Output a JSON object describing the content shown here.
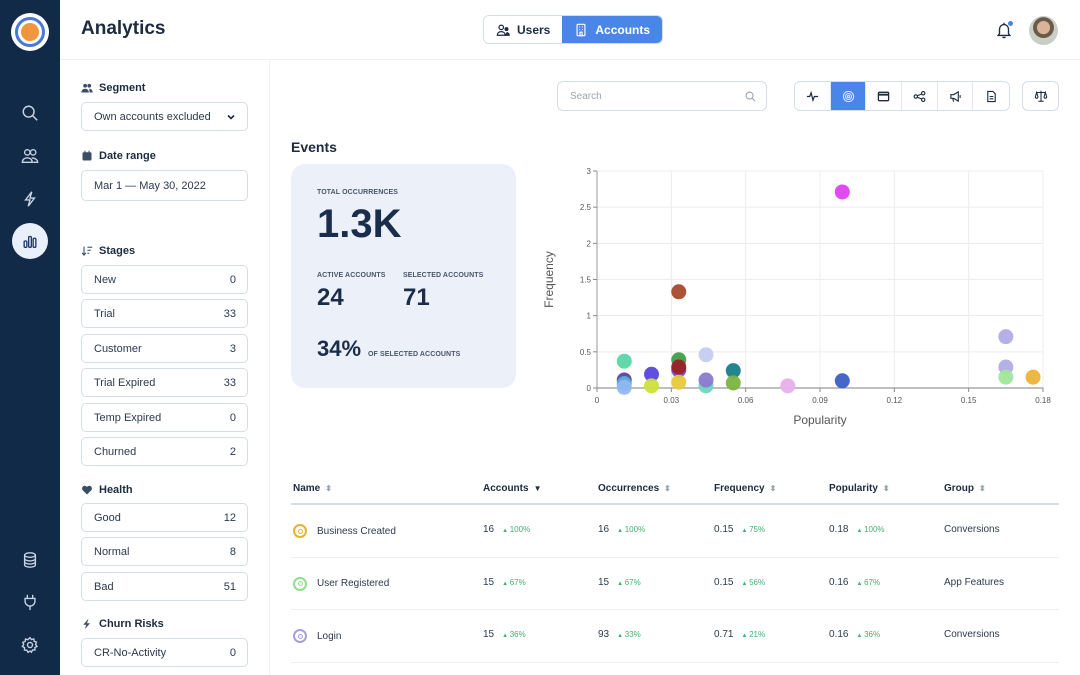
{
  "header": {
    "title": "Analytics",
    "toggle": [
      {
        "label": "Users",
        "icon": "users-icon",
        "active": false
      },
      {
        "label": "Accounts",
        "icon": "building-icon",
        "active": true
      }
    ],
    "notifications_icon": "bell-icon",
    "avatar": "user-avatar"
  },
  "rail": {
    "top_items": [
      {
        "name": "search",
        "icon": "search-icon"
      },
      {
        "name": "people",
        "icon": "people-icon"
      },
      {
        "name": "events",
        "icon": "lightning-icon"
      },
      {
        "name": "analytics",
        "icon": "bar-chart-icon",
        "active": true
      }
    ],
    "bottom_items": [
      {
        "name": "data",
        "icon": "database-icon"
      },
      {
        "name": "integrations",
        "icon": "plug-icon"
      },
      {
        "name": "settings",
        "icon": "gear-icon"
      }
    ]
  },
  "filters": {
    "segment": {
      "label": "Segment",
      "value": "Own accounts excluded"
    },
    "date_range": {
      "label": "Date range",
      "value": "Mar 1 — May 30, 2022"
    },
    "stages": {
      "label": "Stages",
      "items": [
        {
          "label": "New",
          "count": "0"
        },
        {
          "label": "Trial",
          "count": "33"
        },
        {
          "label": "Customer",
          "count": "3"
        },
        {
          "label": "Trial Expired",
          "count": "33"
        },
        {
          "label": "Temp Expired",
          "count": "0"
        },
        {
          "label": "Churned",
          "count": "2"
        }
      ]
    },
    "health": {
      "label": "Health",
      "items": [
        {
          "label": "Good",
          "count": "12"
        },
        {
          "label": "Normal",
          "count": "8"
        },
        {
          "label": "Bad",
          "count": "51"
        }
      ]
    },
    "churn_risks": {
      "label": "Churn Risks",
      "items": [
        {
          "label": "CR-No-Activity",
          "count": "0"
        }
      ]
    }
  },
  "toolbar": {
    "search_placeholder": "Search",
    "views": [
      {
        "name": "pulse",
        "icon": "pulse-icon",
        "active": false
      },
      {
        "name": "target",
        "icon": "target-icon",
        "active": true
      },
      {
        "name": "window",
        "icon": "window-icon",
        "active": false
      },
      {
        "name": "share",
        "icon": "share-nodes-icon",
        "active": false
      },
      {
        "name": "announce",
        "icon": "megaphone-icon",
        "active": false
      },
      {
        "name": "document",
        "icon": "document-icon",
        "active": false
      }
    ],
    "compare_icon": "scale-icon"
  },
  "events": {
    "title": "Events",
    "total_occurrences_label": "TOTAL OCCURRENCES",
    "total_occurrences": "1.3K",
    "active_accounts_label": "ACTIVE ACCOUNTS",
    "active_accounts": "24",
    "selected_accounts_label": "SELECTED ACCOUNTS",
    "selected_accounts": "71",
    "percent": "34%",
    "percent_label": "OF SELECTED ACCOUNTS"
  },
  "chart_data": {
    "type": "scatter",
    "title": "",
    "xlabel": "Popularity",
    "ylabel": "Frequency",
    "xlim": [
      0,
      0.18
    ],
    "ylim": [
      0,
      3
    ],
    "xticks": [
      "0",
      "0.03",
      "0.06",
      "0.09",
      "0.12",
      "0.15",
      "0.18"
    ],
    "yticks": [
      "0",
      "0.5",
      "1",
      "1.5",
      "2",
      "2.5",
      "3"
    ],
    "grid": true,
    "legend": "none",
    "points": [
      {
        "x": 0.099,
        "y": 2.71,
        "color": "#e040f0"
      },
      {
        "x": 0.033,
        "y": 1.33,
        "color": "#a84a2c"
      },
      {
        "x": 0.165,
        "y": 0.71,
        "color": "#b1ace6"
      },
      {
        "x": 0.165,
        "y": 0.29,
        "color": "#b1ace6"
      },
      {
        "x": 0.165,
        "y": 0.15,
        "color": "#9fe89a"
      },
      {
        "x": 0.176,
        "y": 0.15,
        "color": "#ecb33a"
      },
      {
        "x": 0.099,
        "y": 0.1,
        "color": "#3b5fc4"
      },
      {
        "x": 0.077,
        "y": 0.03,
        "color": "#e6b0ec"
      },
      {
        "x": 0.055,
        "y": 0.24,
        "color": "#178089"
      },
      {
        "x": 0.055,
        "y": 0.07,
        "color": "#7cb342"
      },
      {
        "x": 0.044,
        "y": 0.46,
        "color": "#c4cdf0"
      },
      {
        "x": 0.044,
        "y": 0.03,
        "color": "#6fd6c0"
      },
      {
        "x": 0.044,
        "y": 0.11,
        "color": "#8a7bd0"
      },
      {
        "x": 0.033,
        "y": 0.39,
        "color": "#3e9e4c"
      },
      {
        "x": 0.033,
        "y": 0.25,
        "color": "#6a4fd8"
      },
      {
        "x": 0.033,
        "y": 0.29,
        "color": "#9b2226"
      },
      {
        "x": 0.033,
        "y": 0.08,
        "color": "#e8c93c"
      },
      {
        "x": 0.022,
        "y": 0.19,
        "color": "#5b45e0"
      },
      {
        "x": 0.022,
        "y": 0.03,
        "color": "#cfe03a"
      },
      {
        "x": 0.011,
        "y": 0.37,
        "color": "#5ad6a8"
      },
      {
        "x": 0.011,
        "y": 0.11,
        "color": "#5a3fa8"
      },
      {
        "x": 0.011,
        "y": 0.06,
        "color": "#5bb0d8"
      },
      {
        "x": 0.011,
        "y": 0.01,
        "color": "#90b8f0"
      }
    ]
  },
  "table": {
    "columns": [
      {
        "label": "Name",
        "sort": "none"
      },
      {
        "label": "Accounts",
        "sort": "desc"
      },
      {
        "label": "Occurrences",
        "sort": "none"
      },
      {
        "label": "Frequency",
        "sort": "none"
      },
      {
        "label": "Popularity",
        "sort": "none"
      },
      {
        "label": "Group",
        "sort": "none"
      }
    ],
    "rows": [
      {
        "icon_color": "#e8b230",
        "name": "Business Created",
        "accounts": "16",
        "accounts_delta": "100%",
        "occurrences": "16",
        "occurrences_delta": "100%",
        "frequency": "0.15",
        "frequency_delta": "75%",
        "popularity": "0.18",
        "popularity_delta": "100%",
        "group": "Conversions"
      },
      {
        "icon_color": "#8fde8a",
        "name": "User Registered",
        "accounts": "15",
        "accounts_delta": "67%",
        "occurrences": "15",
        "occurrences_delta": "67%",
        "frequency": "0.15",
        "frequency_delta": "56%",
        "popularity": "0.16",
        "popularity_delta": "67%",
        "group": "App Features"
      },
      {
        "icon_color": "#a99ee0",
        "name": "Login",
        "accounts": "15",
        "accounts_delta": "36%",
        "occurrences": "93",
        "occurrences_delta": "33%",
        "frequency": "0.71",
        "frequency_delta": "21%",
        "popularity": "0.16",
        "popularity_delta": "36%",
        "group": "Conversions"
      }
    ]
  },
  "colors": {
    "rail_bg": "#112a48",
    "accent": "#4a86e8",
    "positive": "#3cb371",
    "stats_bg": "#ebf0f9"
  }
}
